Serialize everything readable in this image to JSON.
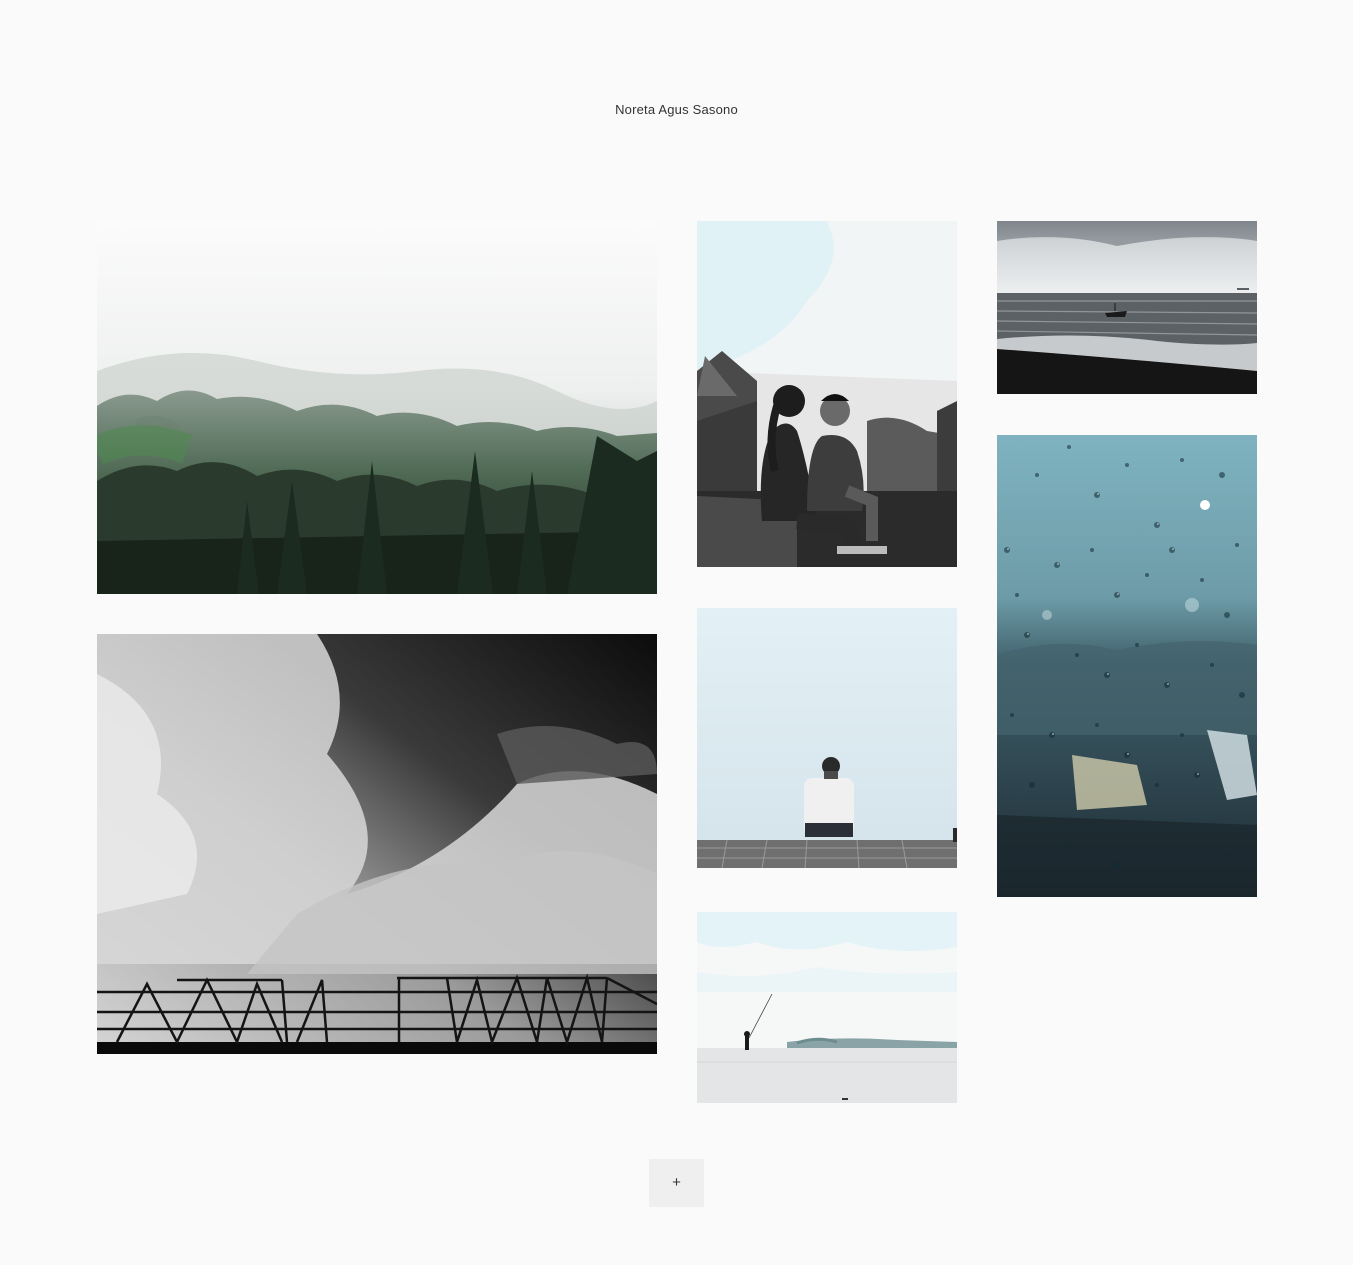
{
  "header": {
    "site_title": "Noreta Agus Sasono"
  },
  "gallery": {
    "photos": [
      {
        "id": "forest",
        "subject": "misty-forest-photo"
      },
      {
        "id": "clouds",
        "subject": "black-and-white-clouds-photo"
      },
      {
        "id": "couple",
        "subject": "couple-sitting-photo"
      },
      {
        "id": "man",
        "subject": "man-sitting-on-pier-photo"
      },
      {
        "id": "fisher",
        "subject": "fisherman-beach-photo"
      },
      {
        "id": "sea",
        "subject": "sea-boat-photo"
      },
      {
        "id": "rain",
        "subject": "raindrops-window-photo"
      }
    ]
  },
  "footer": {
    "load_more_label": "+"
  },
  "colors": {
    "background": "#fafafa",
    "button_bg": "#efefef",
    "text": "#333333"
  }
}
